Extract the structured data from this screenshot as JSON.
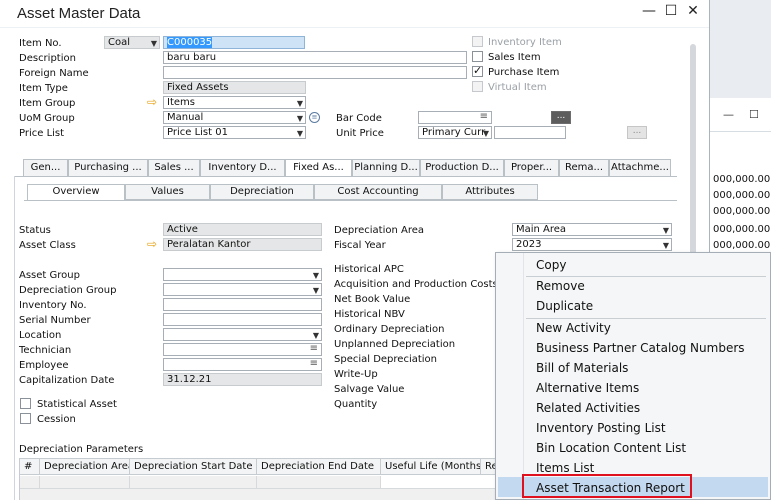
{
  "window": {
    "title": "Asset Master Data",
    "controls": [
      "—",
      "☐",
      "✕"
    ]
  },
  "background_window": {
    "values": [
      "000,000.00",
      "000,000.00",
      "000,000.00",
      "000,000.00",
      "000,000.00"
    ]
  },
  "header": {
    "item_no": {
      "label": "Item No.",
      "series": "Coal",
      "value": "C000035"
    },
    "description": {
      "label": "Description",
      "value": "baru baru"
    },
    "foreign_name": {
      "label": "Foreign Name",
      "value": ""
    },
    "item_type": {
      "label": "Item Type",
      "value": "Fixed Assets"
    },
    "item_group": {
      "label": "Item Group",
      "value": "Items"
    },
    "uom_group": {
      "label": "UoM Group",
      "value": "Manual"
    },
    "price_list": {
      "label": "Price List",
      "value": "Price List 01"
    },
    "bar_code": {
      "label": "Bar Code",
      "value": ""
    },
    "unit_price": {
      "label": "Unit Price",
      "currency": "Primary Curr",
      "value": ""
    },
    "checkboxes": {
      "inventory_item": "Inventory Item",
      "sales_item": "Sales Item",
      "purchase_item": "Purchase Item",
      "virtual_item": "Virtual Item"
    },
    "dots": "..."
  },
  "tabs": [
    "Gen...",
    "Purchasing ...",
    "Sales ...",
    "Inventory D...",
    "Fixed As...",
    "Planning D...",
    "Production D...",
    "Proper...",
    "Rema...",
    "Attachme..."
  ],
  "subtabs": [
    "Overview",
    "Values",
    "Depreciation",
    "Cost Accounting",
    "Attributes"
  ],
  "overview": {
    "status": {
      "label": "Status",
      "value": "Active"
    },
    "asset_class": {
      "label": "Asset Class",
      "value": "Peralatan Kantor"
    },
    "asset_group": "Asset Group",
    "depreciation_group": "Depreciation Group",
    "inventory_no": "Inventory No.",
    "serial_number": "Serial Number",
    "location": "Location",
    "technician": "Technician",
    "employee": "Employee",
    "capitalization_date": {
      "label": "Capitalization Date",
      "value": "31.12.21"
    },
    "statistical_asset": "Statistical Asset",
    "cession": "Cession",
    "depreciation_area": {
      "label": "Depreciation Area",
      "value": "Main Area"
    },
    "fiscal_year": {
      "label": "Fiscal Year",
      "value": "2023"
    },
    "right_labels": [
      "Historical APC",
      "Acquisition and Production Costs",
      "Net Book Value",
      "Historical NBV",
      "Ordinary Depreciation",
      "Unplanned Depreciation",
      "Special Depreciation",
      "Write-Up",
      "Salvage Value",
      "Quantity"
    ]
  },
  "depreciation_parameters": {
    "title": "Depreciation Parameters",
    "columns": [
      "#",
      "Depreciation Area",
      "Depreciation Start Date",
      "Depreciation End Date",
      "Useful Life (Months)",
      "Re"
    ]
  },
  "context_menu": {
    "items": [
      "Copy",
      "Remove",
      "Duplicate",
      "New Activity",
      "Business Partner Catalog Numbers",
      "Bill of Materials",
      "Alternative Items",
      "Related Activities",
      "Inventory Posting List",
      "Bin Location Content List",
      "Items List",
      "Asset Transaction Report"
    ],
    "highlighted": "Asset Transaction Report"
  }
}
